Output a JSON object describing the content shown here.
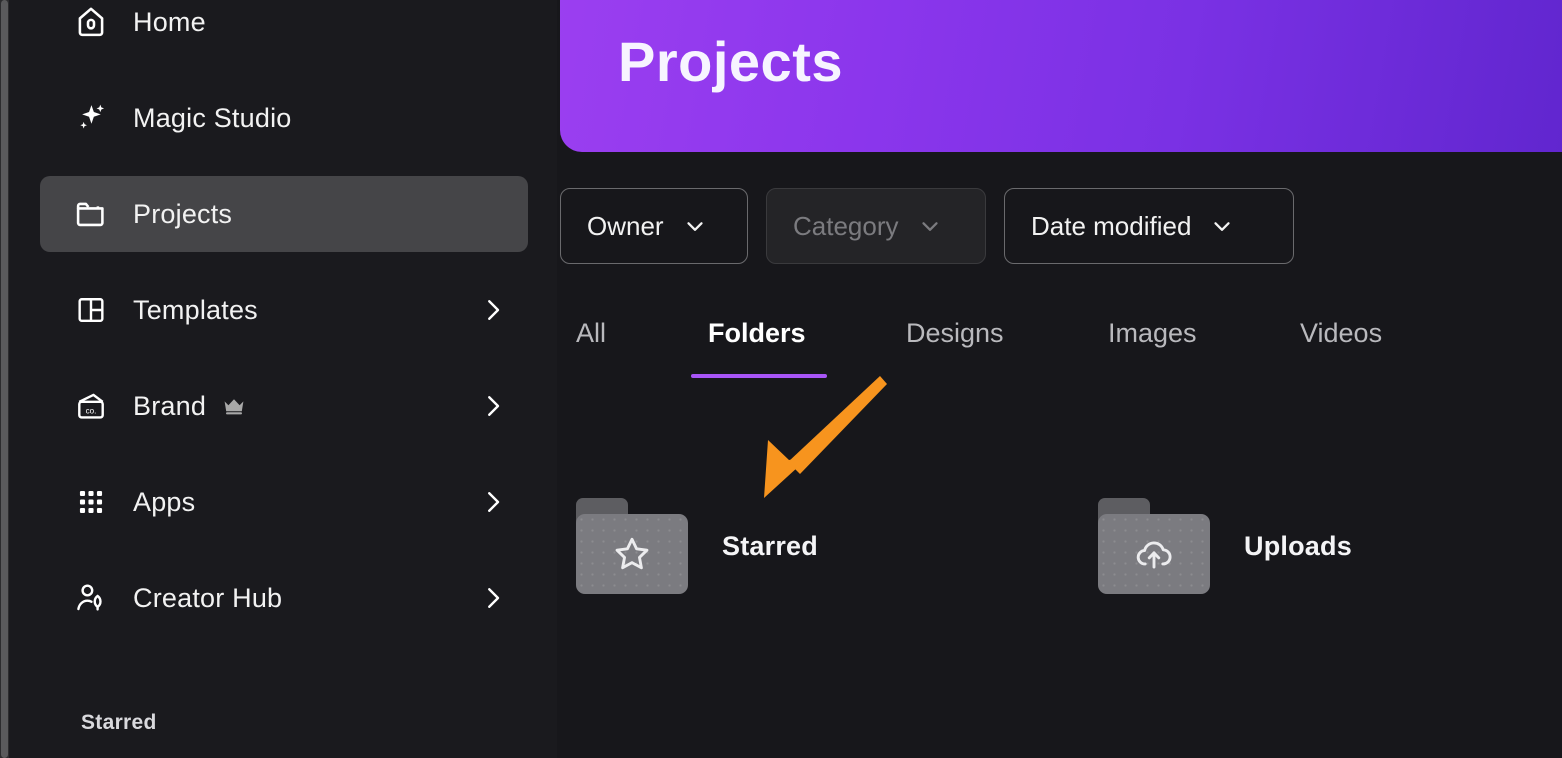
{
  "app": {
    "background_color": "#17171b",
    "sidebar_color": "#1a1a1e",
    "accent_color": "#a855f7"
  },
  "sidebar": {
    "items": [
      {
        "label": "Home",
        "icon": "home-icon",
        "active": false,
        "has_chevron": false,
        "premium": false
      },
      {
        "label": "Magic Studio",
        "icon": "sparkles-icon",
        "active": false,
        "has_chevron": false,
        "premium": false
      },
      {
        "label": "Projects",
        "icon": "folder-icon",
        "active": true,
        "has_chevron": false,
        "premium": false
      },
      {
        "label": "Templates",
        "icon": "layout-icon",
        "active": false,
        "has_chevron": true,
        "premium": false
      },
      {
        "label": "Brand",
        "icon": "brand-card-icon",
        "active": false,
        "has_chevron": true,
        "premium": true
      },
      {
        "label": "Apps",
        "icon": "grid-dots-icon",
        "active": false,
        "has_chevron": true,
        "premium": false
      },
      {
        "label": "Creator Hub",
        "icon": "creator-pen-icon",
        "active": false,
        "has_chevron": true,
        "premium": false
      }
    ],
    "section_label": "Starred"
  },
  "header": {
    "title": "Projects",
    "gradient_start": "#9b3ff0",
    "gradient_end": "#6126cf"
  },
  "filters": [
    {
      "label": "Owner",
      "disabled": false
    },
    {
      "label": "Category",
      "disabled": true
    },
    {
      "label": "Date modified",
      "disabled": false
    }
  ],
  "tabs": [
    {
      "label": "All",
      "active": false
    },
    {
      "label": "Folders",
      "active": true
    },
    {
      "label": "Designs",
      "active": false
    },
    {
      "label": "Images",
      "active": false
    },
    {
      "label": "Videos",
      "active": false
    }
  ],
  "folders": [
    {
      "name": "Starred",
      "icon": "star-icon"
    },
    {
      "name": "Uploads",
      "icon": "cloud-upload-icon"
    }
  ],
  "annotation": {
    "type": "arrow",
    "color": "#f7941e",
    "points_to": "Folders tab / Starred folder"
  }
}
